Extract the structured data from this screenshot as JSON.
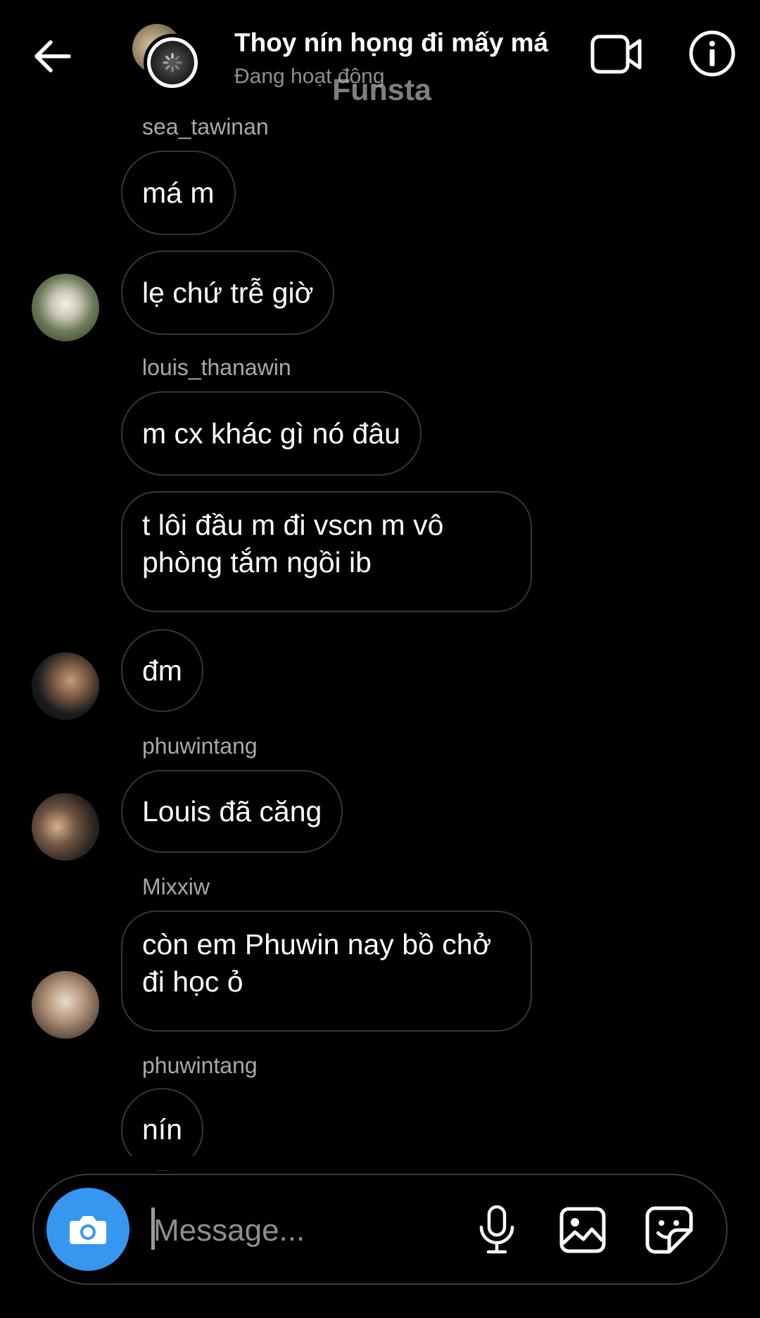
{
  "header": {
    "title": "Thoy nín họng đi mấy má",
    "status": "Đang hoạt động",
    "watermark": "Funsta"
  },
  "messages": [
    {
      "sender": "sea_tawinan",
      "lines": [
        "má m",
        "lẹ chứ trễ giờ"
      ]
    },
    {
      "sender": "louis_thanawin",
      "lines": [
        "m cx khác gì nó đâu",
        "t lôi đầu m đi vscn m vô phòng tắm ngồi ib",
        "đm"
      ]
    },
    {
      "sender": "phuwintang",
      "lines": [
        "Louis đã căng"
      ]
    },
    {
      "sender": "Mixxiw",
      "lines": [
        "còn em Phuwin nay bồ chở đi học ỏ"
      ]
    },
    {
      "sender": "phuwintang",
      "lines": [
        "nín"
      ]
    }
  ],
  "composer": {
    "placeholder": "Message..."
  },
  "colors": {
    "background": "#000000",
    "camera_button": "#3797f0",
    "bubble_border": "#363636",
    "secondary_text": "#a8a8a8"
  },
  "icons": [
    "back-arrow-icon",
    "video-call-icon",
    "info-icon",
    "camera-icon",
    "microphone-icon",
    "gallery-icon",
    "sticker-icon"
  ]
}
